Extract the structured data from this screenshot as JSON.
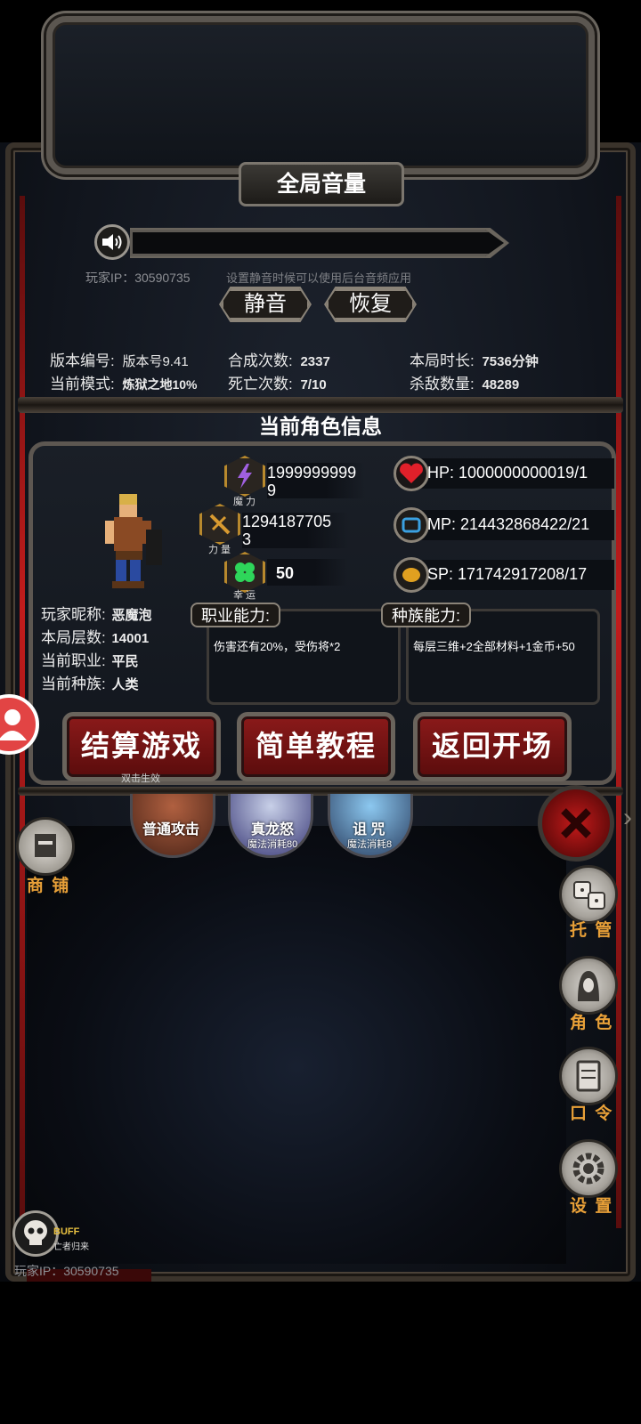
{
  "volume_panel": {
    "title": "全局音量",
    "ip_label": "玩家IP：",
    "ip_value": "30590735",
    "hint": "设置静音时候可以使用后台音频应用",
    "mute_label": "静音",
    "restore_label": "恢复"
  },
  "stats": {
    "version_label": "版本编号:",
    "version_value": "版本号9.41",
    "mode_label": "当前模式:",
    "mode_value": "炼狱之地10%",
    "craft_label": "合成次数:",
    "craft_value": "2337",
    "death_label": "死亡次数:",
    "death_value": "7/10",
    "duration_label": "本局时长:",
    "duration_value": "7536分钟",
    "kills_label": "杀敌数量:",
    "kills_value": "48289"
  },
  "character": {
    "section_title": "当前角色信息",
    "nickname_label": "玩家昵称:",
    "nickname_value": "恶魔泡",
    "floor_label": "本局层数:",
    "floor_value": "14001",
    "job_label": "当前职业:",
    "job_value": "平民",
    "race_label": "当前种族:",
    "race_value": "人类",
    "attributes": {
      "magic_value_line1": "1999999999",
      "magic_value_line2": "9",
      "magic_label": "魔 力",
      "strength_value_line1": "1294187705",
      "strength_value_line2": "3",
      "strength_label": "力 量",
      "luck_value": "50",
      "luck_label": "幸 运"
    },
    "resources": {
      "hp": "HP:  1000000000019/1",
      "mp": "MP:  214432868422/21",
      "sp": "SP:  171742917208/17"
    },
    "job_ability_label": "职业能力:",
    "job_ability_text": "伤害还有20%，受伤将*2",
    "race_ability_label": "种族能力:",
    "race_ability_text": "每层三维+2全部材料+1金币+50"
  },
  "buttons": {
    "settle_label": "结算游戏",
    "settle_sub": "双击生效",
    "tutorial_label": "简单教程",
    "return_label": "返回开场"
  },
  "skills": [
    {
      "name": "普通攻击",
      "cost": ""
    },
    {
      "name": "真龙怒",
      "cost": "魔法消耗80"
    },
    {
      "name": "诅 咒",
      "cost": "魔法消耗8"
    }
  ],
  "side_menu": {
    "shop_label": "商 铺",
    "auto_label": "托 管",
    "role_label": "角 色",
    "code_label": "口 令",
    "settings_label": "设 置"
  },
  "buff": {
    "tag": "BUFF",
    "name": "亡者归来"
  },
  "footer": {
    "ip_text": "玩家IP：30590735"
  },
  "colors": {
    "accent_orange": "#e8a038",
    "button_red": "#8b1a1a",
    "gold_border": "#b8892d"
  }
}
